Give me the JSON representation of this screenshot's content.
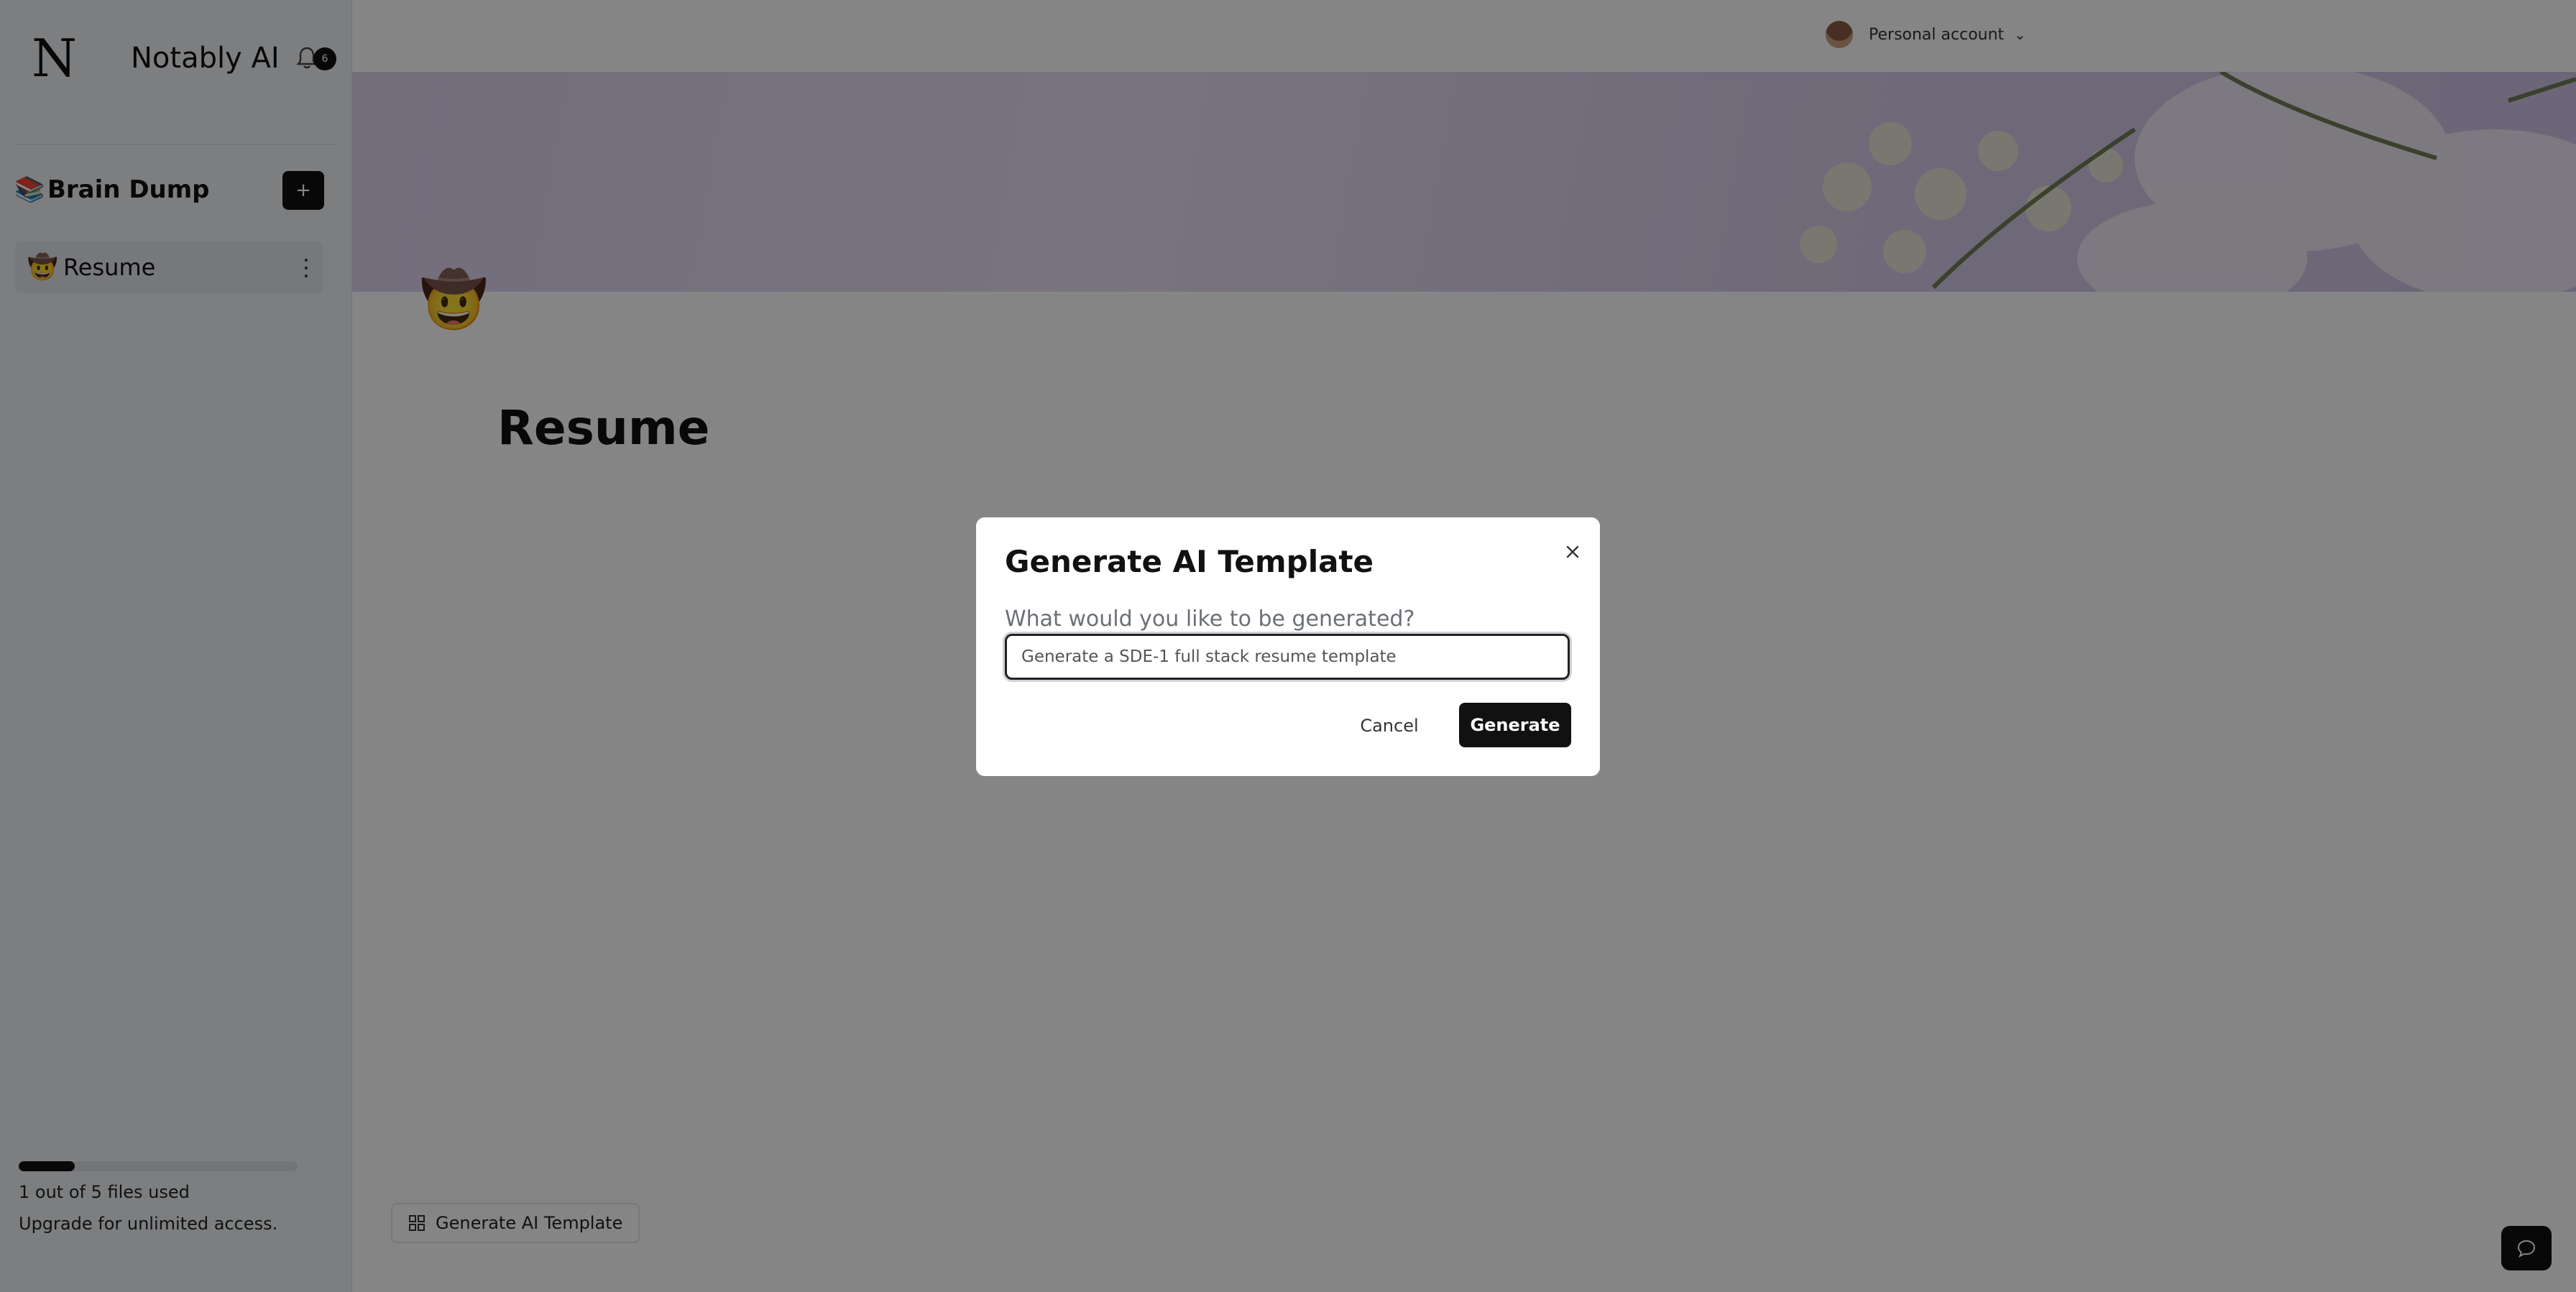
{
  "app": {
    "name": "Notably AI",
    "logo_text": "N",
    "notification_count": "6"
  },
  "sidebar": {
    "workspace": {
      "icon": "📚",
      "title": "Brain Dump",
      "add_label": "+"
    },
    "documents": [
      {
        "icon": "🤠",
        "label": "Resume",
        "more_label": "⋮"
      }
    ],
    "usage": {
      "used": 1,
      "total": 5,
      "fraction": 0.2,
      "text": "1 out of 5 files used"
    },
    "upgrade_text": "Upgrade for unlimited access."
  },
  "header": {
    "account_label": "Personal account",
    "chevron": "⌄"
  },
  "page": {
    "emoji": "🤠",
    "title": "Resume"
  },
  "footer": {
    "generate_template_label": "Generate AI Template"
  },
  "modal": {
    "title": "Generate AI Template",
    "question": "What would you like to be generated?",
    "input_value": "Generate a SDE-1 full stack resume template",
    "cancel_label": "Cancel",
    "generate_label": "Generate"
  },
  "colors": {
    "accent": "#111111",
    "overlay": "rgba(0,0,0,0.48)",
    "sidebar_bg": "#eef1f5",
    "cover": "#d9cfee"
  }
}
